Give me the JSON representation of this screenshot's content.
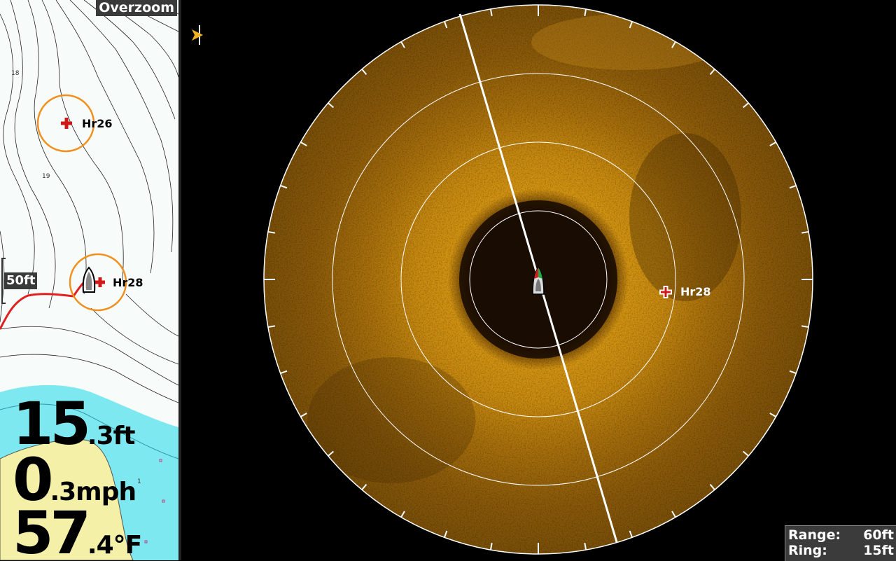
{
  "map": {
    "overzoom_label": "Overzoom",
    "depth_labels": [
      "18",
      "19",
      "1"
    ],
    "scale_label": "50ft",
    "waypoints": [
      {
        "name": "Hr26",
        "icon": "waypoint-cross-icon"
      },
      {
        "name": "Hr28",
        "icon": "waypoint-cross-icon"
      }
    ],
    "colors": {
      "shallow_water": "#7de8ef",
      "land": "#f5f0a8",
      "track": "#e02020",
      "waypoint_ring": "#f0901e"
    }
  },
  "readouts": {
    "depth": {
      "big": "15",
      "small": ".3ft"
    },
    "speed": {
      "big": "0",
      "small": ".3mph"
    },
    "temp": {
      "big": "57",
      "small": ".4°F"
    }
  },
  "sonar": {
    "waypoint_label": "Hr28",
    "colors": {
      "echo": "#c88a10",
      "ring": "#ffffff",
      "sweep": "#ffffff"
    }
  },
  "range_box": {
    "range_label": "Range:",
    "range_value": "60ft",
    "ring_label": "Ring:",
    "ring_value": "15ft"
  }
}
